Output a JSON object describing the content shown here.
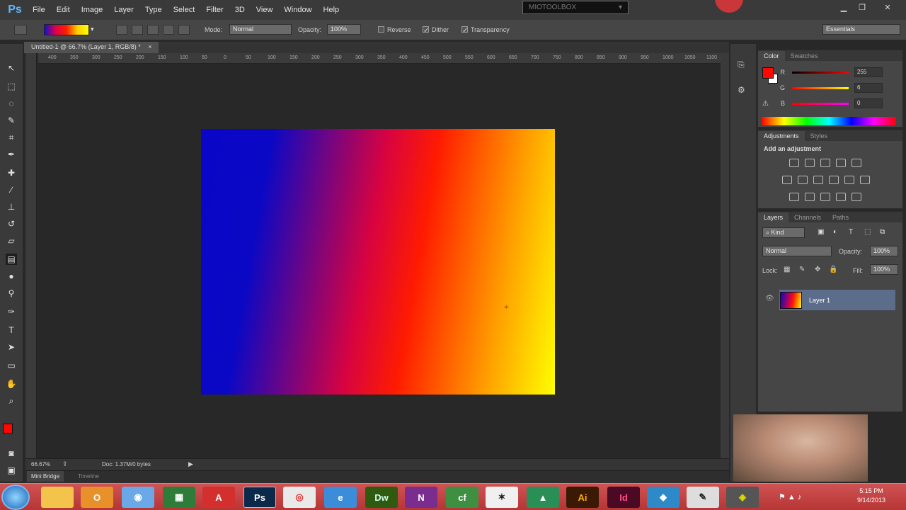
{
  "app": {
    "logo": "Ps"
  },
  "menu": [
    "File",
    "Edit",
    "Image",
    "Layer",
    "Type",
    "Select",
    "Filter",
    "3D",
    "View",
    "Window",
    "Help"
  ],
  "top_badge": "MIOTOOLBOX",
  "options": {
    "mode_label": "Mode:",
    "mode_value": "Normal",
    "opacity_label": "Opacity:",
    "opacity_value": "100%",
    "reverse_label": "Reverse",
    "dither_label": "Dither",
    "transparency_label": "Transparency",
    "workspace": "Essentials"
  },
  "document": {
    "tab_title": "Untitled-1 @ 66.7% (Layer 1, RGB/8) *",
    "close": "×"
  },
  "ruler_ticks": [
    "400",
    "350",
    "300",
    "250",
    "200",
    "150",
    "100",
    "50",
    "0",
    "50",
    "100",
    "150",
    "200",
    "250",
    "300",
    "350",
    "400",
    "450",
    "500",
    "550",
    "600",
    "650",
    "700",
    "750",
    "800",
    "850",
    "900",
    "950",
    "1000",
    "1050",
    "1100"
  ],
  "status": {
    "zoom": "66.67%",
    "doc": "Doc: 1.37M/0 bytes"
  },
  "bottom_tabs": {
    "mini_bridge": "Mini Bridge",
    "timeline": "Timeline"
  },
  "color_panel": {
    "tabs": [
      "Color",
      "Swatches"
    ],
    "r_label": "R",
    "r_value": "255",
    "g_label": "G",
    "g_value": "6",
    "b_label": "B",
    "b_value": "0",
    "fg": "#ff0600"
  },
  "adjustments_panel": {
    "tabs": [
      "Adjustments",
      "Styles"
    ],
    "heading": "Add an adjustment"
  },
  "layers_panel": {
    "tabs": [
      "Layers",
      "Channels",
      "Paths"
    ],
    "kind": "Kind",
    "blend": "Normal",
    "opacity_label": "Opacity:",
    "opacity_value": "100%",
    "lock_label": "Lock:",
    "fill_label": "Fill:",
    "fill_value": "100%",
    "layers": [
      {
        "name": "Layer 1"
      }
    ]
  },
  "taskbar": {
    "apps": [
      "Explorer",
      "Outlook",
      "Browser",
      "Tasks",
      "Acrobat",
      "Ps",
      "Chrome",
      "IE",
      "Dw",
      "N",
      "Cf",
      "Motion",
      "Projects",
      "Ai",
      "Id",
      "Stack",
      "Tool",
      "Media"
    ],
    "time": "5:15 PM",
    "date": "9/14/2013"
  }
}
